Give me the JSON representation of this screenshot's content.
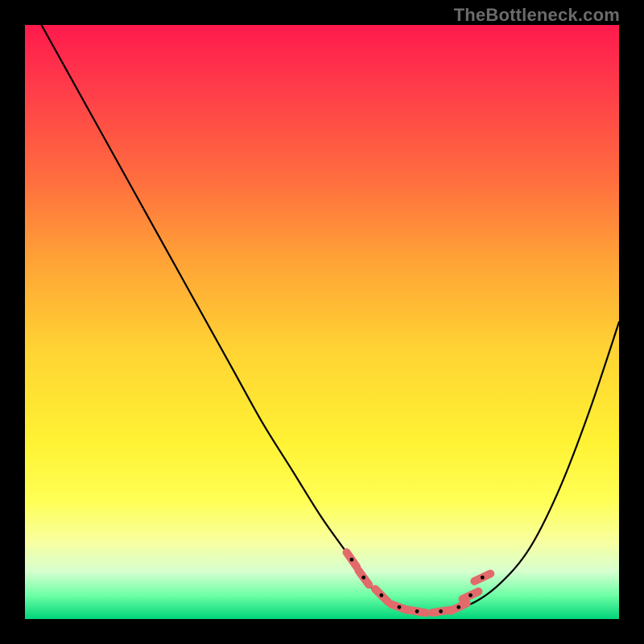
{
  "watermark": "TheBottleneck.com",
  "colors": {
    "background": "#000000",
    "curve": "#000000",
    "marker": "#e26a6a",
    "gradient_stops": [
      "#ff1a4d",
      "#ff3a4a",
      "#ff6a3f",
      "#ffa436",
      "#ffd433",
      "#fff233",
      "#ffff55",
      "#f8ffa0",
      "#d6ffcf",
      "#6effa6",
      "#00d47a"
    ]
  },
  "chart_data": {
    "type": "line",
    "title": "",
    "xlabel": "",
    "ylabel": "",
    "xlim": [
      0,
      100
    ],
    "ylim": [
      0,
      100
    ],
    "series": [
      {
        "name": "bottleneck-curve",
        "x": [
          0,
          5,
          10,
          15,
          20,
          25,
          30,
          35,
          40,
          45,
          50,
          55,
          57,
          59,
          61,
          63,
          65,
          67,
          70,
          75,
          80,
          85,
          90,
          95,
          100
        ],
        "y": [
          105,
          96,
          87,
          78,
          69,
          60,
          51,
          42,
          33,
          25,
          17,
          10,
          7,
          4.5,
          3,
          2,
          1.5,
          1.3,
          1.3,
          2.5,
          6,
          12,
          22,
          35,
          50
        ]
      }
    ],
    "markers": [
      {
        "x": 55,
        "y": 10,
        "type": "segment-end"
      },
      {
        "x": 57,
        "y": 7,
        "type": "segment-end"
      },
      {
        "x": 60,
        "y": 4,
        "type": "segment-end"
      },
      {
        "x": 63,
        "y": 2,
        "type": "segment-end"
      },
      {
        "x": 66,
        "y": 1.3,
        "type": "segment-end"
      },
      {
        "x": 70,
        "y": 1.3,
        "type": "segment-end"
      },
      {
        "x": 73,
        "y": 2.0,
        "type": "segment-end"
      },
      {
        "x": 75,
        "y": 4.0,
        "type": "segment-end"
      },
      {
        "x": 77,
        "y": 7.0,
        "type": "segment-end"
      }
    ]
  }
}
